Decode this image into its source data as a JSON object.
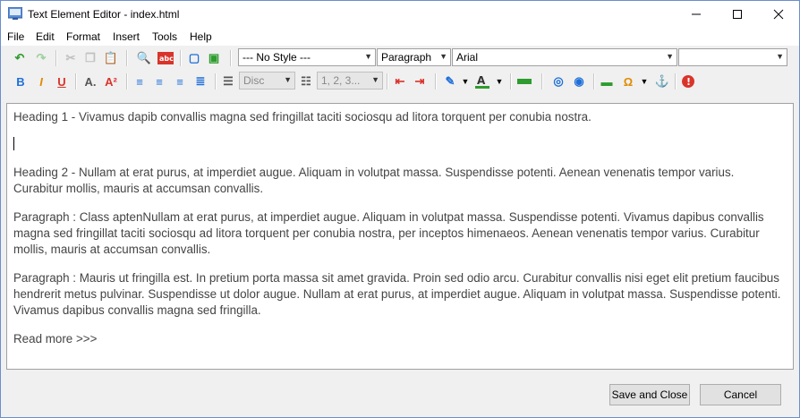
{
  "window": {
    "title": "Text Element Editor - index.html"
  },
  "menu": [
    "File",
    "Edit",
    "Format",
    "Insert",
    "Tools",
    "Help"
  ],
  "toolbar": {
    "style_combo": "--- No Style ---",
    "block_combo": "Paragraph",
    "font_combo": "Arial",
    "size_combo": "",
    "bullet_combo": "Disc",
    "number_combo": "1, 2, 3..."
  },
  "editor": {
    "lines": [
      "Heading 1 - Vivamus dapib convallis magna sed fringillat taciti sociosqu ad litora torquent per conubia nostra.",
      "Heading 2 - Nullam at erat purus, at imperdiet augue. Aliquam in volutpat massa. Suspendisse potenti. Aenean venenatis tempor varius. Curabitur mollis, mauris at accumsan convallis.",
      "Paragraph : Class aptenNullam at erat purus, at imperdiet augue. Aliquam in volutpat massa. Suspendisse potenti. Vivamus dapibus convallis magna sed fringillat taciti sociosqu ad litora torquent per conubia nostra, per inceptos himenaeos. Aenean venenatis tempor varius. Curabitur mollis, mauris at accumsan convallis.",
      "Paragraph : Mauris ut fringilla est. In pretium porta massa sit amet gravida. Proin sed odio arcu. Curabitur convallis nisi eget elit pretium faucibus hendrerit metus pulvinar. Suspendisse ut dolor augue. Nullam at erat purus, at imperdiet augue. Aliquam in volutpat massa. Suspendisse potenti. Vivamus dapibus convallis magna sed fringilla.",
      "Read more >>>"
    ]
  },
  "buttons": {
    "save": "Save and Close",
    "cancel": "Cancel"
  },
  "colors": {
    "accent": "#1e6fd9",
    "undo": "#2e9c2e",
    "text_color": "#444444"
  }
}
